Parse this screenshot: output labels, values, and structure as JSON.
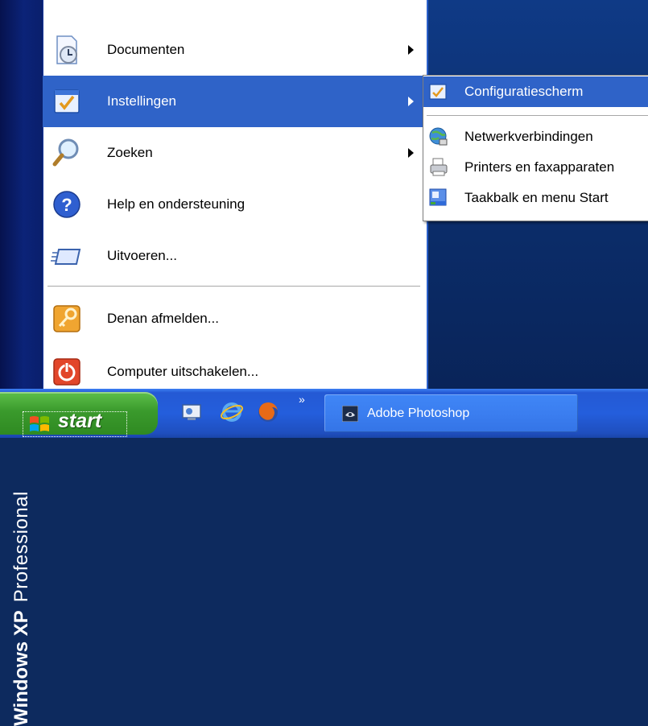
{
  "sidebar": {
    "brand": "Windows XP",
    "edition": "Professional"
  },
  "menu": {
    "items": [
      {
        "label": "Documenten",
        "icon": "recent-documents-icon",
        "has_submenu": true,
        "selected": false
      },
      {
        "label": "Instellingen",
        "icon": "settings-icon",
        "has_submenu": true,
        "selected": true
      },
      {
        "label": "Zoeken",
        "icon": "search-icon",
        "has_submenu": true,
        "selected": false
      },
      {
        "label": "Help en ondersteuning",
        "icon": "help-icon",
        "has_submenu": false,
        "selected": false
      },
      {
        "label": "Uitvoeren...",
        "icon": "run-icon",
        "has_submenu": false,
        "selected": false
      }
    ],
    "logoff": {
      "label": "Denan afmelden...",
      "icon": "logoff-key-icon"
    },
    "shutdown": {
      "label": "Computer uitschakelen...",
      "icon": "power-icon"
    }
  },
  "submenu": {
    "items": [
      {
        "label": "Configuratiescherm",
        "icon": "control-panel-icon",
        "selected": true
      },
      {
        "label": "Netwerkverbindingen",
        "icon": "network-connections-icon",
        "selected": false
      },
      {
        "label": "Printers en faxapparaten",
        "icon": "printers-icon",
        "selected": false
      },
      {
        "label": "Taakbalk en menu Start",
        "icon": "taskbar-icon",
        "selected": false
      }
    ]
  },
  "taskbar": {
    "start_label": "start",
    "quick_launch": [
      "show-desktop-icon",
      "internet-explorer-icon",
      "firefox-icon"
    ],
    "chevron": "»",
    "task_label": "Adobe Photoshop",
    "task_icon": "photoshop-icon"
  },
  "colors": {
    "selection": "#2f63c8",
    "taskbar": "#245edc",
    "start_button": "#3a9a2c",
    "sidebar": "#0b2378"
  }
}
